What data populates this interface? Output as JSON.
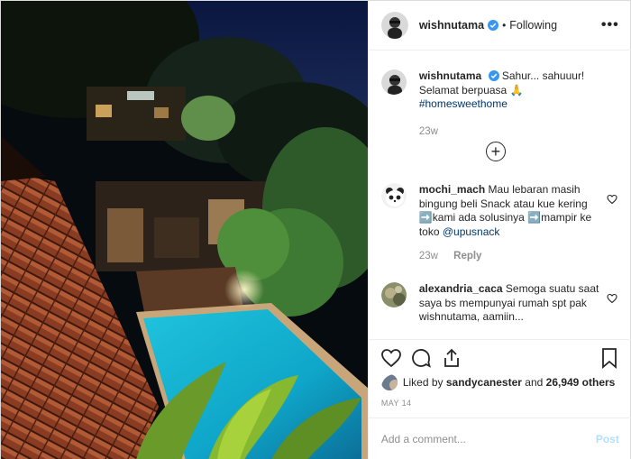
{
  "post": {
    "author": {
      "username": "wishnutama",
      "verified": true,
      "follow_status": "Following",
      "separator": "•"
    },
    "more_glyph": "•••",
    "caption": {
      "username": "wishnutama",
      "text": "Sahur... sahuuur! Selamat berpuasa 🙏",
      "hashtag": "#homesweethome",
      "age": "23w"
    },
    "comments": [
      {
        "username": "mochi_mach",
        "text_a": "Mau lebaran masih bingung beli Snack atau kue kering ",
        "emoji_a": "➡️",
        "text_b": "kami ada solusinya ",
        "emoji_b": "➡️",
        "text_c": "mampir ke toko ",
        "mention": "@upusnack",
        "age": "23w",
        "reply_label": "Reply"
      },
      {
        "username": "alexandria_caca",
        "text": "Semoga suatu saat saya bs mempunyai rumah spt pak wishnutama, aamiin..."
      }
    ],
    "likes": {
      "prefix": "Liked by ",
      "user": "sandycanester",
      "middle": " and ",
      "count": "26,949 others"
    },
    "date": "MAY 14",
    "add_comment": {
      "placeholder": "Add a comment...",
      "post_label": "Post"
    },
    "colors": {
      "link": "#00376b",
      "verified": "#3897f0",
      "muted": "#8e8e8e",
      "post_btn": "#b2dffc"
    },
    "icons": [
      "verified-badge-icon",
      "more-options-icon",
      "load-more-comments-icon",
      "heart-icon",
      "comment-icon",
      "share-icon",
      "bookmark-icon",
      "comment-heart-icon"
    ]
  }
}
